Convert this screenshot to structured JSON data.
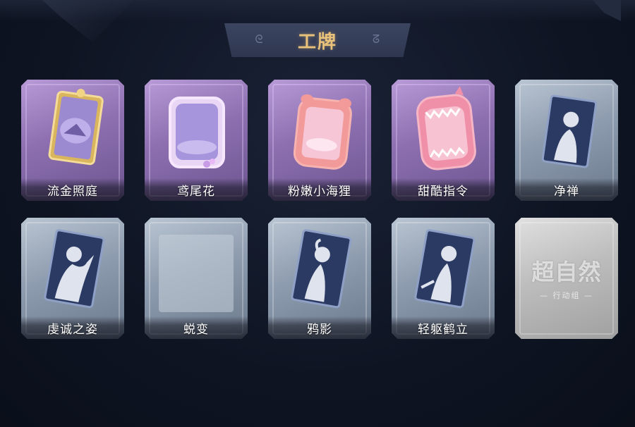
{
  "header": {
    "title": "工牌"
  },
  "colors": {
    "title_gold": "#e8c27a",
    "card_purple": "#8d6fb0",
    "card_grey": "#8e9caf",
    "card_silver": "#bdbdbd"
  },
  "cards": [
    {
      "label": "流金照庭",
      "tier": "purple",
      "art": "golden-frame-badge"
    },
    {
      "label": "鸢尾花",
      "tier": "purple",
      "art": "iris-badge"
    },
    {
      "label": "粉嫩小海狸",
      "tier": "purple",
      "art": "pink-beaver-badge"
    },
    {
      "label": "甜酷指令",
      "tier": "purple",
      "art": "shark-mouth-badge"
    },
    {
      "label": "净禅",
      "tier": "grey",
      "art": "silhouette-badge"
    },
    {
      "label": "虔诚之姿",
      "tier": "grey",
      "art": "silhouette-badge"
    },
    {
      "label": "蜕变",
      "tier": "grey",
      "art": "blank-badge"
    },
    {
      "label": "鸦影",
      "tier": "grey",
      "art": "silhouette-badge"
    },
    {
      "label": "轻躯鹤立",
      "tier": "grey",
      "art": "silhouette-badge"
    },
    {
      "label": "",
      "tier": "silver",
      "art": "watermark-logo",
      "watermark": {
        "main": "超自然",
        "sub": "— 行动组 —"
      }
    }
  ]
}
